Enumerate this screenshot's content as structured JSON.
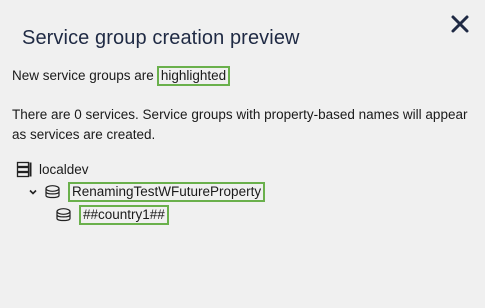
{
  "dialog": {
    "title": "Service group creation preview",
    "close_icon": "close-icon"
  },
  "intro": {
    "prefix": "New service groups are",
    "highlight_word": "highlighted",
    "highlight_color": "#6ab04c"
  },
  "description": "There are 0 services. Service groups with property-based names will appear as services are created.",
  "tree": {
    "root": {
      "label": "localdev",
      "icon": "server-stack-icon"
    },
    "group": {
      "label": "RenamingTestWFutureProperty",
      "icon": "layers-icon",
      "expanded": true
    },
    "child": {
      "label": "##country1##",
      "icon": "layers-icon"
    }
  }
}
